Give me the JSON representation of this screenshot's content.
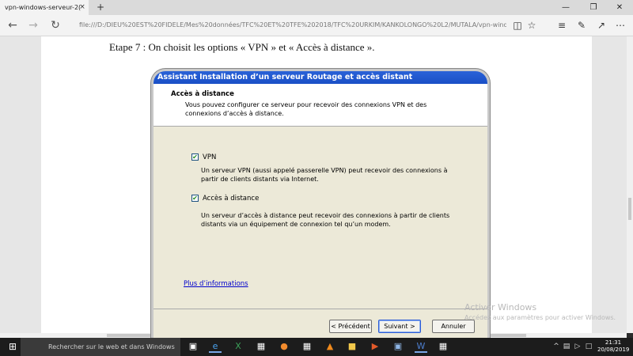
{
  "browser": {
    "tab_title": "vpn-windows-serveur-2(",
    "tab_close": "×",
    "new_tab": "+",
    "address": "file:///D:/DIEU%20EST%20FIDELE/Mes%20données/TFC%20ET%20TFE%202018/TFC%20URKIM/KANKOLONGO%20L2/MUTALA/vpn-windo",
    "icons": [
      "back-arrow-icon",
      "forward-arrow-icon",
      "refresh-icon",
      "reading-view-icon",
      "favorite-star-icon",
      "hub-icon",
      "notes-icon",
      "share-icon",
      "more-icon"
    ]
  },
  "document": {
    "step_text": "Etape 7 : On choisit les options « VPN » et « Accès à distance »."
  },
  "dialog": {
    "title": "Assistant Installation d’un serveur Routage et accès distant",
    "header_title": "Accès à distance",
    "header_desc": "Vous pouvez configurer ce serveur pour recevoir des connexions VPN et des connexions d’accès à distance.",
    "options": [
      {
        "label": "VPN",
        "checked": true,
        "check": "✔",
        "desc": "Un serveur VPN (aussi appelé passerelle VPN) peut recevoir des connexions à partir de clients distants via Internet."
      },
      {
        "label": "Accès à distance",
        "checked": true,
        "check": "✔",
        "desc": "Un serveur d’accès à distance peut recevoir des connexions à partir de clients distants via un équipement de connexion tel qu’un modem."
      }
    ],
    "more_link": "Plus d’informations",
    "buttons": {
      "back": "< Précédent",
      "next": "Suivant >",
      "cancel": "Annuler"
    }
  },
  "watermark": {
    "line1": "Activer Windows",
    "line2": "Accédez aux paramètres pour activer Windows."
  },
  "taskbar": {
    "search_text": "Rechercher sur le web et dans Windows",
    "apps": [
      "task-view-icon",
      "edge-icon",
      "excel-icon",
      "store-icon",
      "firefox-icon",
      "photos-icon",
      "vlc-icon",
      "explorer-icon",
      "media-icon",
      "virtualbox-icon",
      "word-icon",
      "app-icon"
    ],
    "clock_time": "21:31",
    "clock_date": "20/08/2019"
  }
}
